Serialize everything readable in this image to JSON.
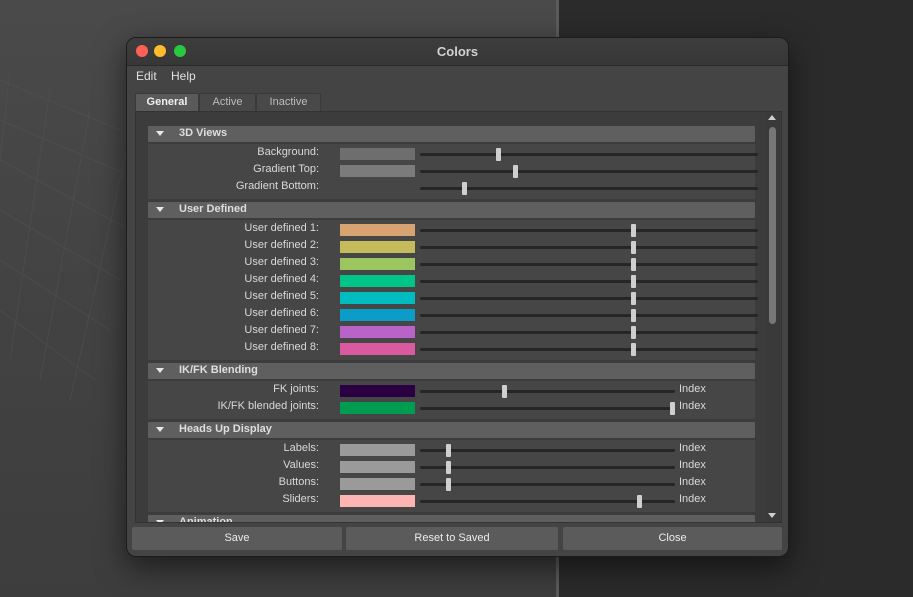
{
  "window": {
    "title": "Colors"
  },
  "menu": [
    "Edit",
    "Help"
  ],
  "tabs": [
    {
      "label": "General",
      "active": true
    },
    {
      "label": "Active",
      "active": false
    },
    {
      "label": "Inactive",
      "active": false
    }
  ],
  "sections": [
    {
      "title": "3D Views",
      "rows": [
        {
          "label": "Background:",
          "color": "#6e6e6e",
          "slider": 0.23,
          "index": false
        },
        {
          "label": "Gradient Top:",
          "color": "#7b7b7b",
          "slider": 0.28,
          "index": false
        },
        {
          "label": "Gradient Bottom:",
          "color": "#464646",
          "slider": 0.13,
          "index": false
        }
      ]
    },
    {
      "title": "User Defined",
      "rows": [
        {
          "label": "User defined 1:",
          "color": "#d7a370",
          "slider": 0.63,
          "index": false
        },
        {
          "label": "User defined 2:",
          "color": "#c6bb5b",
          "slider": 0.63,
          "index": false
        },
        {
          "label": "User defined 3:",
          "color": "#9bc55f",
          "slider": 0.63,
          "index": false
        },
        {
          "label": "User defined 4:",
          "color": "#00c589",
          "slider": 0.63,
          "index": false
        },
        {
          "label": "User defined 5:",
          "color": "#00bcbf",
          "slider": 0.63,
          "index": false
        },
        {
          "label": "User defined 6:",
          "color": "#0c9cc8",
          "slider": 0.63,
          "index": false
        },
        {
          "label": "User defined 7:",
          "color": "#b763c7",
          "slider": 0.63,
          "index": false
        },
        {
          "label": "User defined 8:",
          "color": "#d95a9e",
          "slider": 0.63,
          "index": false
        }
      ]
    },
    {
      "title": "IK/FK Blending",
      "rows": [
        {
          "label": "FK joints:",
          "color": "#2a0042",
          "slider": 0.33,
          "index": true
        },
        {
          "label": "IK/FK blended joints:",
          "color": "#009c52",
          "slider": 0.99,
          "index": true
        }
      ]
    },
    {
      "title": "Heads Up Display",
      "rows": [
        {
          "label": "Labels:",
          "color": "#9a9a9a",
          "slider": 0.11,
          "index": true
        },
        {
          "label": "Values:",
          "color": "#9a9a9a",
          "slider": 0.11,
          "index": true
        },
        {
          "label": "Buttons:",
          "color": "#9a9a9a",
          "slider": 0.11,
          "index": true
        },
        {
          "label": "Sliders:",
          "color": "#ffb4b4",
          "slider": 0.86,
          "index": true
        }
      ]
    },
    {
      "title": "Animation",
      "rows": []
    }
  ],
  "index_label": "Index",
  "footer": {
    "save_label": "Save",
    "reset_label": "Reset to Saved",
    "close_label": "Close"
  }
}
